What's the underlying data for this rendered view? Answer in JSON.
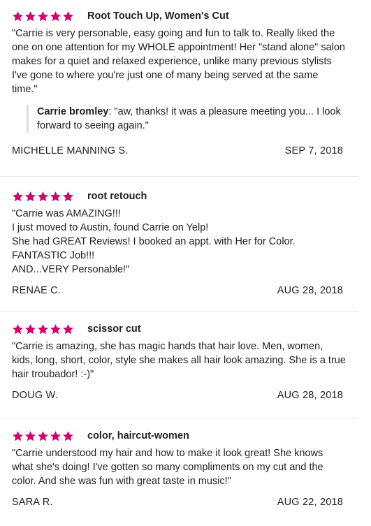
{
  "colors": {
    "star": "#d4006f",
    "text": "#1f1f1f",
    "divider": "#e6e6e6",
    "reply_bar": "#dcdcdc"
  },
  "reviews": [
    {
      "rating": 5,
      "service": "Root Touch Up, Women's Cut",
      "text": "\"Carrie is very personable, easy going and fun to talk to. Really liked the one on one attention for my WHOLE appointment! Her \"stand alone\" salon makes for a quiet and relaxed experience, unlike many previous stylists I've gone to where you're just one of many being served at the same time.\"",
      "reply": {
        "name": "Carrie bromley",
        "text": ": \"aw, thanks! it was a pleasure meeting you... I look forward to seeing again.\""
      },
      "author": "MICHELLE MANNING S.",
      "date": "SEP 7, 2018"
    },
    {
      "rating": 5,
      "service": "root retouch",
      "text": "\"Carrie was AMAZING!!!\nI just moved to Austin, found Carrie on Yelp!\nShe had GREAT Reviews!  I booked an appt. with Her for Color.\nFANTASTIC Job!!!\nAND...VERY Personable!\"",
      "author": "RENAE C.",
      "date": "AUG 28, 2018"
    },
    {
      "rating": 5,
      "service": "scissor cut",
      "text": "\"Carrie is amazing, she has magic hands that hair love.  Men, women, kids, long, short, color, style she makes all hair look amazing.    She is a true hair troubador!  :-)\"",
      "author": "DOUG W.",
      "date": "AUG 28, 2018"
    },
    {
      "rating": 5,
      "service": "color, haircut-women",
      "text": "\"Carrie understood my hair and how to make it look great! She knows what she's doing! I've gotten so many compliments on my cut and the color. And she was fun with great taste in music!\"",
      "author": "SARA R.",
      "date": "AUG 22, 2018"
    }
  ]
}
